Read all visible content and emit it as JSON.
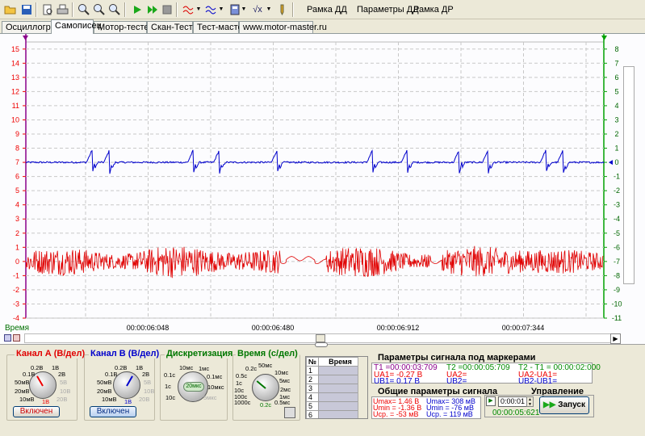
{
  "toolbar": {
    "buttons": [
      "open-icon",
      "save-icon",
      "print-preview-icon",
      "print-icon",
      "zoom-in-icon",
      "zoom-out-icon",
      "zoom-fit-icon",
      "play-icon",
      "play-step-icon",
      "stop-icon",
      "filter-icon",
      "filter2-icon",
      "calculator-icon",
      "sqrt-icon",
      "probe-icon"
    ],
    "menu": [
      "Рамка ДД",
      "Параметры ДД",
      "Рамка ДР"
    ]
  },
  "tabs": [
    "Осциллограф",
    "Самописец",
    "Мотор-тестер",
    "Скан-Тестер",
    "Тест-мастер",
    "www.motor-master.ru"
  ],
  "active_tab": 1,
  "chart_data": {
    "type": "line",
    "xlabel": "Время",
    "x_ticks": [
      "00:00:06:048",
      "00:00:06:480",
      "00:00:06:912",
      "00:00:07:344"
    ],
    "y_left_ticks": [
      15,
      14,
      13,
      12,
      11,
      10,
      9,
      8,
      7,
      6,
      5,
      4,
      3,
      2,
      1,
      0,
      -1,
      -2,
      -3,
      -4
    ],
    "y_right_ticks": [
      8,
      7,
      6,
      5,
      4,
      3,
      2,
      1,
      0,
      -1,
      -2,
      -3,
      -4,
      -5,
      -6,
      -7,
      -8,
      -9,
      -10,
      -11
    ],
    "ylim_left": [
      -4,
      15.5
    ],
    "ylim_right": [
      -11,
      8.5
    ],
    "series": [
      {
        "color": "#0000cc",
        "axis": "right",
        "baseline": 0,
        "pulses": [
          {
            "t": 0.115,
            "dir": 1
          },
          {
            "t": 0.145,
            "dir": 1
          },
          {
            "t": 0.29,
            "dir": -1
          },
          {
            "t": 0.335,
            "dir": 1
          },
          {
            "t": 0.435,
            "dir": 1
          },
          {
            "t": 0.6,
            "dir": 1
          },
          {
            "t": 0.66,
            "dir": 1
          },
          {
            "t": 0.75,
            "dir": -1
          },
          {
            "t": 0.8,
            "dir": 1
          },
          {
            "t": 0.9,
            "dir": 1
          },
          {
            "t": 0.93,
            "dir": 1
          }
        ]
      },
      {
        "color": "#e00000",
        "axis": "left",
        "baseline": 0,
        "amplitude": 1.0,
        "quiet_ranges": [
          [
            0.44,
            0.52
          ],
          [
            0.7,
            0.72
          ]
        ]
      }
    ]
  },
  "bottom": {
    "chA": {
      "title": "Канал А (В/дел)",
      "labels": [
        "0.2В",
        "1В",
        "0.1В",
        "2В",
        "50мВ",
        "5В",
        "20мВ",
        "10В",
        "10мВ",
        "20В",
        "1В"
      ],
      "button": "Включен"
    },
    "chB": {
      "title": "Канал В (В/дел)",
      "labels": [
        "0.2В",
        "1В",
        "0.1В",
        "2В",
        "50мВ",
        "5В",
        "20мВ",
        "10В",
        "10мВ",
        "20В",
        "1В"
      ],
      "button": "Включен"
    },
    "disc": {
      "title": "Дискретизация",
      "labels": [
        "10мс",
        "1мс",
        "0.1с",
        "0.1мс",
        "1с",
        "20мкс",
        "10мкс",
        "10с",
        "5мкс"
      ]
    },
    "time": {
      "title": "Время (с/дел)",
      "labels": [
        "0.2с",
        "50мс",
        "0.5с",
        "10мс",
        "1с",
        "5мс",
        "10с",
        "2мс",
        "100с",
        "1мс",
        "1000с",
        "0.5мс",
        "0.2с"
      ]
    },
    "marker_table": {
      "col1": "№",
      "col2": "Время",
      "rows": [
        "1",
        "2",
        "3",
        "4",
        "5",
        "6"
      ]
    },
    "markers": {
      "title": "Параметры сигнала под маркерами",
      "t1": "T1 =00:00:03:709",
      "t2": "T2 =00:00:05:709",
      "dt": "T2 - T1 = 00:00:02:000",
      "ua1": "UA1= -0.27 В",
      "ub1": "UB1= 0.17 В",
      "ua2": "UA2=",
      "ub2": "UB2=",
      "uad": "UA2-UA1=",
      "ubd": "UB2-UB1="
    },
    "general": {
      "title": "Общие параметры сигнала",
      "a_max": "Umax= 1.46 В",
      "a_min": "Umin = -1.36 В",
      "a_avg": "Uср. = -53 мВ",
      "b_max": "Umax= 308 мВ",
      "b_min": "Umin = -76 мВ",
      "b_avg": "Uср. = 119 мВ"
    },
    "control": {
      "title": "Управление",
      "time_input": "0:00:01",
      "elapsed": "00:00:05:621",
      "start_label": "Запуск"
    }
  }
}
